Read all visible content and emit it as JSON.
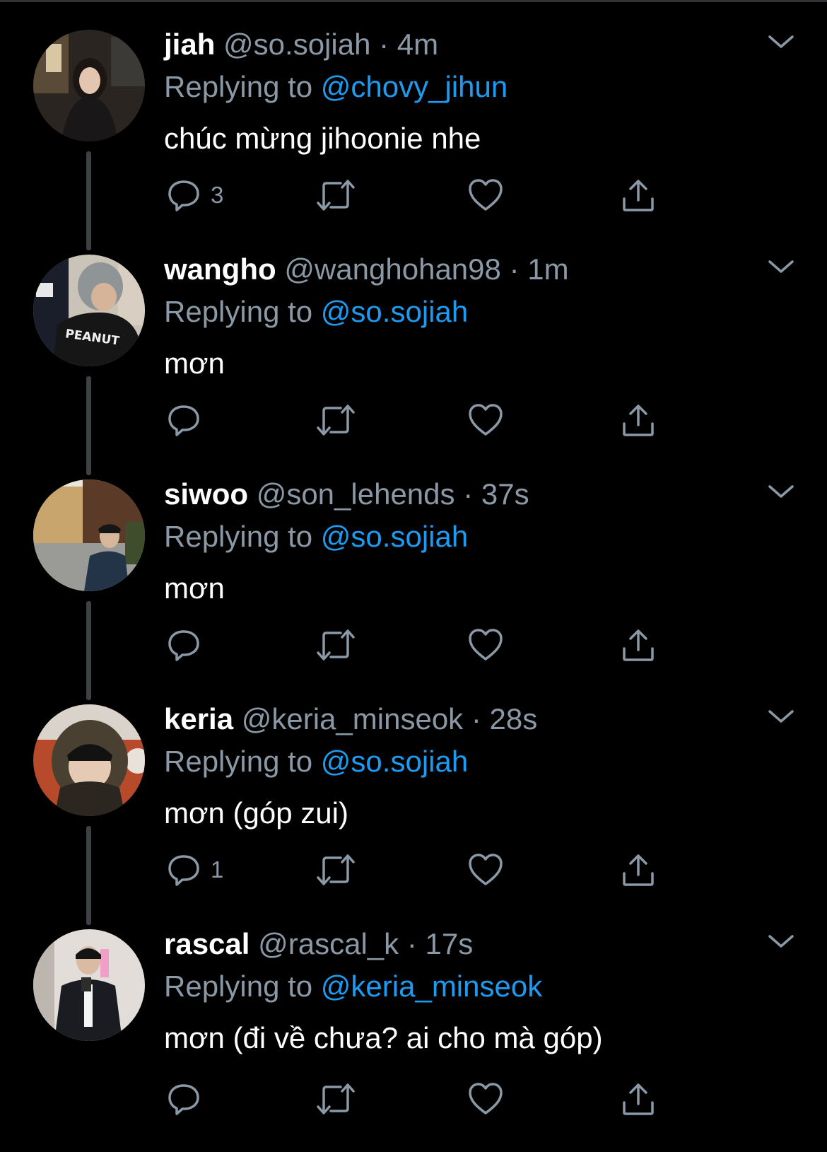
{
  "colors": {
    "background": "#000000",
    "text": "#ffffff",
    "secondary": "#8b98a5",
    "accent": "#1d9bf0",
    "thread_line": "#3d4145"
  },
  "replying_label": "Replying to",
  "tweets": [
    {
      "name": "jiah",
      "handle": "@so.sojiah",
      "dot": "·",
      "time": "4m",
      "replying_to": "@chovy_jihun",
      "text": "chúc mừng jihoonie nhe",
      "reply_count": "3"
    },
    {
      "name": "wangho",
      "handle": "@wanghohan98",
      "dot": "·",
      "time": "1m",
      "replying_to": "@so.sojiah",
      "text": "mơn",
      "reply_count": ""
    },
    {
      "name": "siwoo",
      "handle": "@son_lehends",
      "dot": "·",
      "time": "37s",
      "replying_to": "@so.sojiah",
      "text": "mơn",
      "reply_count": ""
    },
    {
      "name": "keria",
      "handle": "@keria_minseok",
      "dot": "·",
      "time": "28s",
      "replying_to": "@so.sojiah",
      "text": "mơn (góp zui)",
      "reply_count": "1"
    },
    {
      "name": "rascal",
      "handle": "@rascal_k",
      "dot": "·",
      "time": "17s",
      "replying_to": "@keria_minseok",
      "text": "mơn (đi về chưa? ai cho mà góp)",
      "reply_count": ""
    }
  ],
  "avatar_badge_text": "PEANUT",
  "icons": {
    "reply": "reply-icon",
    "retweet": "retweet-icon",
    "like": "heart-icon",
    "share": "share-icon",
    "more": "chevron-down-icon"
  }
}
